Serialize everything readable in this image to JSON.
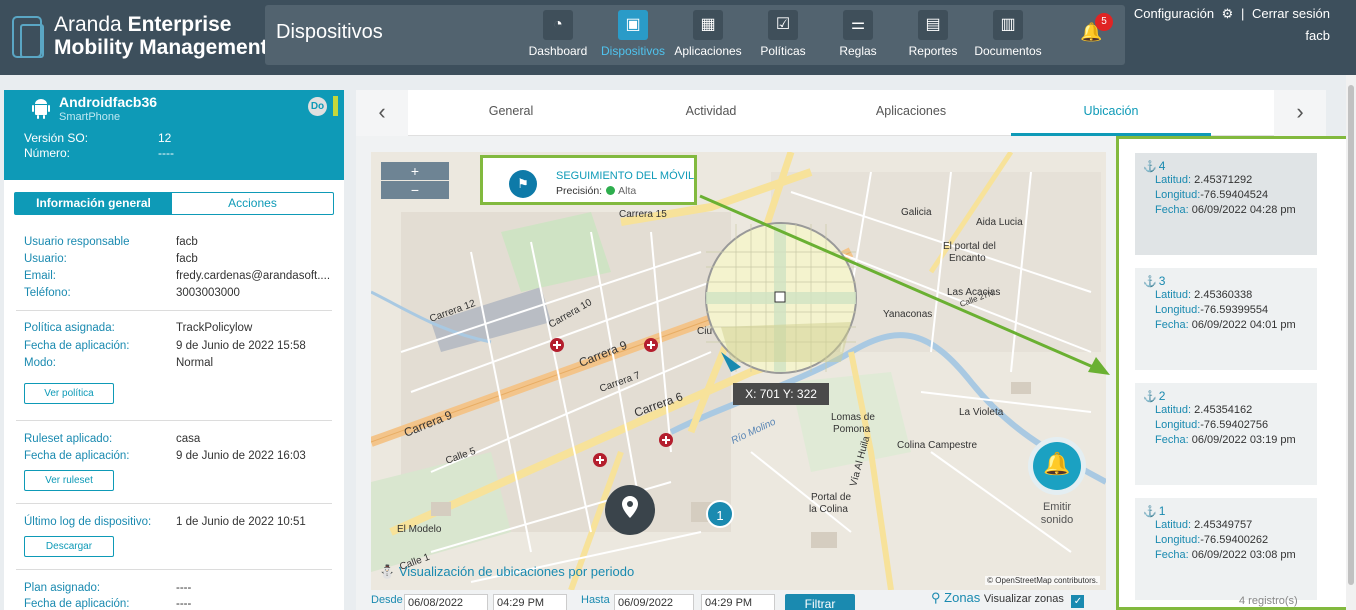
{
  "brand": {
    "line1_light": "Aranda ",
    "line1_bold": "Enterprise",
    "line2": "Mobility Management"
  },
  "header": {
    "page_title": "Dispositivos",
    "nav": [
      {
        "label": "Dashboard",
        "icon": "dashboard-icon",
        "glyph": "◔"
      },
      {
        "label": "Dispositivos",
        "icon": "devices-icon",
        "glyph": "▣"
      },
      {
        "label": "Aplicaciones",
        "icon": "apps-grid-icon",
        "glyph": "▦"
      },
      {
        "label": "Políticas",
        "icon": "checklist-icon",
        "glyph": "☑"
      },
      {
        "label": "Reglas",
        "icon": "rules-icon",
        "glyph": "⚌"
      },
      {
        "label": "Reportes",
        "icon": "reports-icon",
        "glyph": "▤"
      },
      {
        "label": "Documentos",
        "icon": "documents-icon",
        "glyph": "▥"
      }
    ],
    "active_nav": "Dispositivos",
    "notifications": "5",
    "config_label": "Configuración",
    "logout_label": "Cerrar sesión",
    "user": "facb"
  },
  "device": {
    "name": "Androidfacb36",
    "type": "SmartPhone",
    "badge": "Do",
    "os_label": "Versión SO:",
    "os_value": "12",
    "number_label": "Número:",
    "number_value": "----"
  },
  "left_tabs": {
    "general": "Información general",
    "actions": "Acciones"
  },
  "info": {
    "responsable_label": "Usuario responsable",
    "responsable": "facb",
    "user_label": "Usuario:",
    "user": "facb",
    "email_label": "Email:",
    "email": "fredy.cardenas@arandasoft....",
    "phone_label": "Teléfono:",
    "phone": "3003003000",
    "policy_label": "Política asignada:",
    "policy": "TrackPolicylow",
    "policy_date_label": "Fecha de aplicación:",
    "policy_date": "9 de Junio de 2022 15:58",
    "mode_label": "Modo:",
    "mode": "Normal",
    "view_policy": "Ver política",
    "ruleset_label": "Ruleset aplicado:",
    "ruleset": "casa",
    "ruleset_date_label": "Fecha de aplicación:",
    "ruleset_date": "9 de Junio de 2022 16:03",
    "view_ruleset": "Ver ruleset",
    "log_label": "Último log de dispositivo:",
    "log": "1 de Junio de 2022 10:51",
    "download": "Descargar",
    "plan_label": "Plan asignado:",
    "plan": "----",
    "plan_date_label": "Fecha de aplicación:",
    "plan_date": "----"
  },
  "tabs": [
    "General",
    "Actividad",
    "Aplicaciones",
    "Ubicación"
  ],
  "active_tab": "Ubicación",
  "map": {
    "zoom_in": "+",
    "zoom_out": "−",
    "tracking_title": "SEGUIMIENTO DEL MÓVIL",
    "precision_label": "Precisión:",
    "precision_value": "Alta",
    "coords": "X: 701 Y: 322",
    "sound_label": "Emitir sonido",
    "cluster": "1",
    "period_link": "Visualización de ubicaciones por periodo",
    "attribution": "© OpenStreetMap contributors.",
    "labels": [
      "Carrera 15",
      "Carrera 9",
      "Carrera 6",
      "Carrera 10",
      "Carrera 12",
      "Carrera 7",
      "Calle 5",
      "Calle 1",
      "Galicia",
      "Aida Lucia",
      "El portal del Encanto",
      "Las Acacias",
      "Yanaconas",
      "La Violeta",
      "Lomas de Pomona",
      "Colina Campestre",
      "Portal de la Colina",
      "El Modelo",
      "Ciu",
      "Río Molino",
      "Vía Al Huila",
      "Calle 27N",
      "Carrera 9"
    ]
  },
  "filter": {
    "from_label": "Desde",
    "from_date": "06/08/2022",
    "from_time": "04:29 PM",
    "to_label": "Hasta",
    "to_date": "06/09/2022",
    "to_time": "04:29 PM",
    "button": "Filtrar",
    "zonas": "Zonas",
    "show_zones": "Visualizar zonas"
  },
  "records": [
    {
      "n": "4",
      "lat": "2.45371292",
      "lon": "-76.59404524",
      "date": "06/09/2022 04:28 pm"
    },
    {
      "n": "3",
      "lat": "2.45360338",
      "lon": "-76.59399554",
      "date": "06/09/2022 04:01 pm"
    },
    {
      "n": "2",
      "lat": "2.45354162",
      "lon": "-76.59402756",
      "date": "06/09/2022 03:19 pm"
    },
    {
      "n": "1",
      "lat": "2.45349757",
      "lon": "-76.59400262",
      "date": "06/09/2022 03:08 pm"
    }
  ],
  "record_labels": {
    "lat": "Latitud:",
    "lon": "Longitud:",
    "date": "Fecha:"
  },
  "records_count": "4 registro(s)",
  "colors": {
    "accent": "#0e9ab7",
    "header": "#3d4f5c",
    "highlight": "#82b93e"
  }
}
